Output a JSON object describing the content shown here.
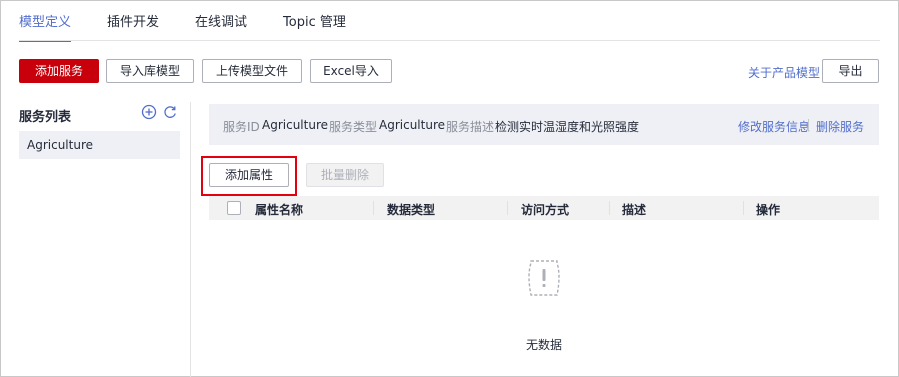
{
  "tabs": [
    {
      "label": "模型定义"
    },
    {
      "label": "插件开发"
    },
    {
      "label": "在线调试"
    },
    {
      "label": "Topic 管理"
    }
  ],
  "toolbar": {
    "add_service": "添加服务",
    "import_library_model": "导入库模型",
    "upload_model_file": "上传模型文件",
    "excel_import": "Excel导入",
    "about_product_model": "关于产品模型",
    "export": "导出"
  },
  "services": {
    "title": "服务列表",
    "items": [
      {
        "name": "Agriculture"
      }
    ]
  },
  "service_info": {
    "id_label": "服务ID",
    "id_value": "Agriculture",
    "type_label": "服务类型",
    "type_value": "Agriculture",
    "desc_label": "服务描述",
    "desc_value": "检测实时温湿度和光照强度",
    "edit_link": "修改服务信息",
    "delete_link": "删除服务"
  },
  "properties": {
    "add_button": "添加属性",
    "batch_delete_button": "批量删除",
    "columns": [
      "属性名称",
      "数据类型",
      "访问方式",
      "描述",
      "操作"
    ],
    "empty_text": "无数据"
  },
  "colors": {
    "primary_red": "#c7000b",
    "link_blue": "#526ecc",
    "highlight_red": "#e3000f"
  }
}
